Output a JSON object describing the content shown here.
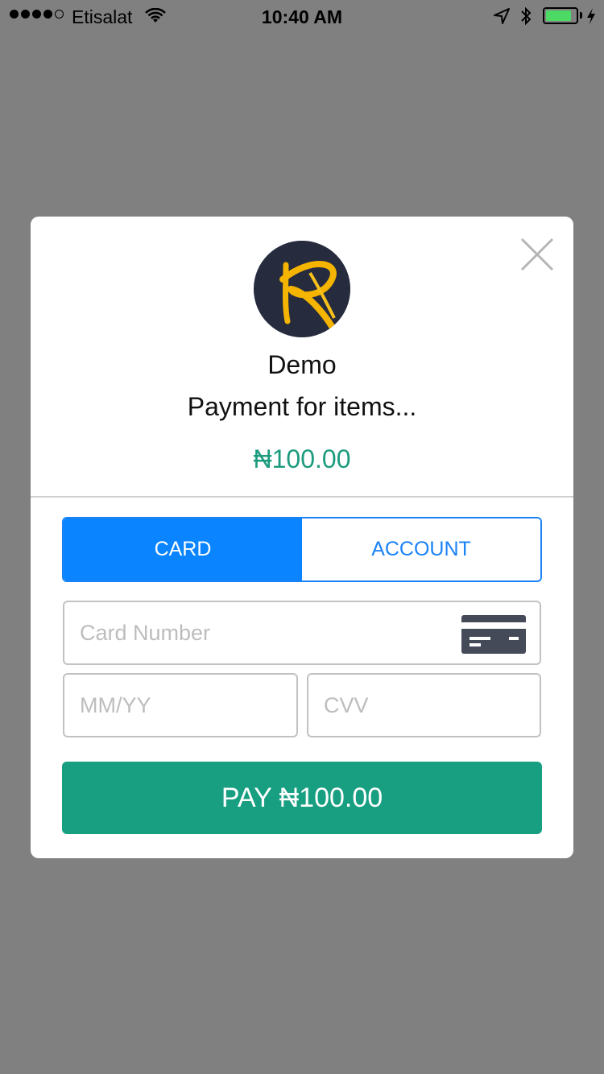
{
  "status_bar": {
    "carrier": "Etisalat",
    "time": "10:40 AM",
    "signal_bars_filled": 4,
    "battery_level": 0.85
  },
  "modal": {
    "merchant_name": "Demo",
    "description": "Payment for items...",
    "amount": "₦100.00",
    "tabs": [
      {
        "label": "CARD",
        "active": true
      },
      {
        "label": "ACCOUNT",
        "active": false
      }
    ],
    "fields": {
      "card_number_placeholder": "Card Number",
      "expiry_placeholder": "MM/YY",
      "cvv_placeholder": "CVV"
    },
    "pay_button_label": "PAY ₦100.00"
  },
  "icons": [
    "wifi-icon",
    "location-arrow-icon",
    "bluetooth-icon",
    "battery-icon",
    "charging-icon",
    "close-icon",
    "merchant-logo",
    "credit-card-icon"
  ],
  "colors": {
    "overlay": "#808080",
    "accent_blue": "#0a84ff",
    "amount_green": "#1d9b7e",
    "pay_green": "#189f81"
  }
}
